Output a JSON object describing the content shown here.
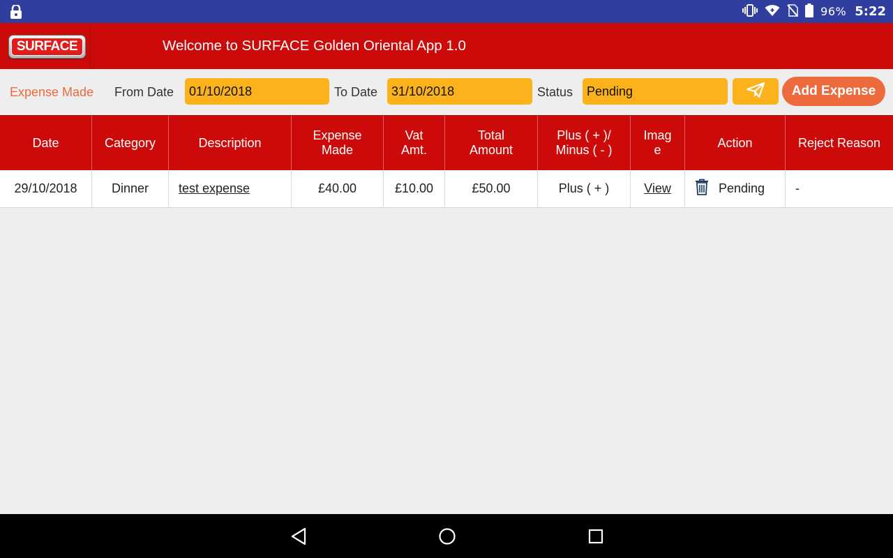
{
  "status_bar": {
    "battery_percent": "96%",
    "time": "5:22",
    "icons": [
      "lock-icon",
      "vibrate-icon",
      "wifi-icon",
      "no-sim-icon",
      "battery-icon"
    ]
  },
  "app_bar": {
    "logo_text": "SURFACE",
    "title": "Welcome to SURFACE Golden Oriental App 1.0"
  },
  "filters": {
    "section_label": "Expense Made",
    "from_label": "From Date",
    "from_value": "01/10/2018",
    "to_label": "To Date",
    "to_value": "31/10/2018",
    "status_label": "Status",
    "status_value": "Pending",
    "send_icon": "paper-plane-icon",
    "add_button": "Add Expense"
  },
  "colors": {
    "header_red": "#cc0a0a",
    "status_blue": "#303f9f",
    "field_yellow": "#fbb21b",
    "accent_orange": "#ec6a3c"
  },
  "table": {
    "headers": {
      "date": "Date",
      "category": "Category",
      "description": "Description",
      "expense_made_1": "Expense",
      "expense_made_2": "Made",
      "vat_1": "Vat",
      "vat_2": "Amt.",
      "total_1": "Total",
      "total_2": "Amount",
      "plus_minus_1": "Plus ( + )/",
      "plus_minus_2": "Minus ( - )",
      "image_1": "Imag",
      "image_2": "e",
      "action": "Action",
      "reject_reason": "Reject Reason"
    },
    "rows": [
      {
        "date": "29/10/2018",
        "category": "Dinner",
        "description": "test expense",
        "expense_made": "£40.00",
        "vat_amt": "£10.00",
        "total_amount": "£50.00",
        "plus_minus": "Plus ( + )",
        "image": "View",
        "action_status": "Pending",
        "reject_reason": "-"
      }
    ]
  }
}
